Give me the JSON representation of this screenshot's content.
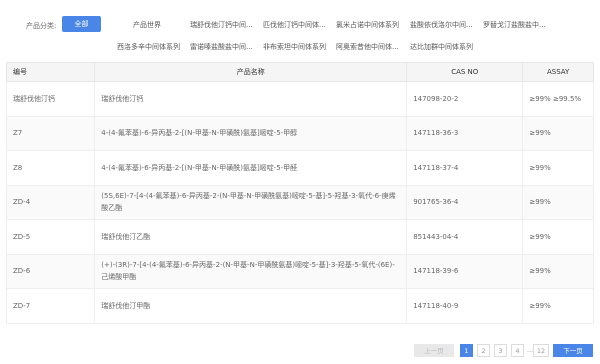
{
  "filter": {
    "label": "产品分类:",
    "all_label": "全部",
    "row1": [
      "产品世界",
      "瑞舒伐他汀钙中间...",
      "匹伐他汀钙中间体...",
      "氯米占诺中间体系列",
      "盐酸依伐洛尔中间...",
      "罗替戈汀盐酸盐中..."
    ],
    "row2": [
      "西洛多辛中间体系列",
      "雷诺嗪盐酸盐中间...",
      "非布索坦中间体系列",
      "阿奥索昔他中间体...",
      "达比加群中间体系列"
    ]
  },
  "table": {
    "headers": [
      "编号",
      "产品名称",
      "CAS NO",
      "ASSAY"
    ],
    "rows": [
      {
        "id": "瑞舒伐他汀钙",
        "name": "瑞舒伐他汀钙",
        "cas": "147098-20-2",
        "assay": "≥99% ≥99.5%"
      },
      {
        "id": "Z7",
        "name": "4-(4-氟苯基)-6-异丙基-2-[(N-甲基-N-甲磺酰)氨基]嘧啶-5-甲醇",
        "cas": "147118-36-3",
        "assay": "≥99%"
      },
      {
        "id": "Z8",
        "name": "4-(4-氟苯基)-6-异丙基-2-[(N-甲基-N-甲磺酰)氨基]嘧啶-5-甲醛",
        "cas": "147118-37-4",
        "assay": "≥99%"
      },
      {
        "id": "ZD-4",
        "name": "(5S,6E)-7-[4-(4-氟苯基)-6-异丙基-2-(N-甲基-N-甲磺酰氨基)嘧啶-5-基]-5-羟基-3-氧代-6-庚烯酸乙酯",
        "cas": "901765-36-4",
        "assay": "≥99%"
      },
      {
        "id": "ZD-5",
        "name": "瑞舒伐他汀乙酯",
        "cas": "851443-04-4",
        "assay": "≥99%"
      },
      {
        "id": "ZD-6",
        "name": "(+)-(3R)-7-[4-(4-氟苯基)-6-异丙基-2-(N-甲基-N-甲磺酰氨基)嘧啶-5-基]-3-羟基-5-氧代-(6E)-己烯酸甲酯",
        "cas": "147118-39-6",
        "assay": "≥99%"
      },
      {
        "id": "ZD-7",
        "name": "瑞舒伐他汀甲酯",
        "cas": "147118-40-9",
        "assay": "≥99%"
      }
    ]
  },
  "pager": {
    "prev": "上一页",
    "pages": [
      "1",
      "2",
      "3",
      "4"
    ],
    "ellipsis": "...",
    "last": "12",
    "next": "下一页",
    "current": "1"
  }
}
